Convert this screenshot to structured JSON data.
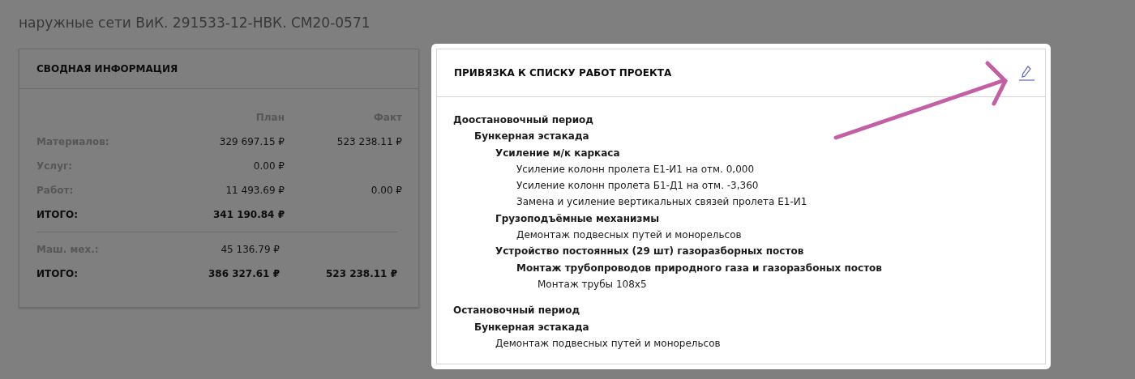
{
  "page_title": "наружные сети ВиК. 291533-12-НВК. СМ20-0571",
  "summary": {
    "title": "СВОДНАЯ ИНФОРМАЦИЯ",
    "columns": [
      "План",
      "Факт"
    ],
    "sections": [
      [
        {
          "label": "Материалов:",
          "plan": "329 697.15 ₽",
          "fact": "523 238.11 ₽",
          "kind": "item"
        },
        {
          "label": "Услуг:",
          "plan": "0.00 ₽",
          "kind": "item"
        },
        {
          "label": "Работ:",
          "plan": "11 493.69 ₽",
          "fact": "0.00 ₽",
          "kind": "item"
        },
        {
          "label": "ИТОГО:",
          "plan": "341 190.84 ₽",
          "kind": "total"
        }
      ],
      [
        {
          "label": "Маш. мех.:",
          "plan": "45 136.79 ₽",
          "kind": "item"
        },
        {
          "label": "ИТОГО:",
          "plan": "386 327.61 ₽",
          "fact": "523 238.11 ₽",
          "kind": "total"
        }
      ]
    ]
  },
  "works": {
    "title": "ПРИВЯЗКА К СПИСКУ РАБОТ ПРОЕКТА",
    "tree": [
      {
        "label": "Доостановочный период",
        "children": [
          {
            "label": "Бункерная эстакада",
            "children": [
              {
                "label": "Усиление м/к каркаса",
                "children": [
                  {
                    "label": "Усиление колонн пролета Е1-И1 на отм. 0,000"
                  },
                  {
                    "label": "Усиление колонн пролета Б1-Д1 на отм. -3,360"
                  },
                  {
                    "label": "Замена и усиление вертикальных связей пролета Е1-И1"
                  }
                ]
              },
              {
                "label": "Грузоподъёмные механизмы",
                "children": [
                  {
                    "label": "Демонтаж подвесных путей и монорельсов"
                  }
                ]
              },
              {
                "label": "Устройство постоянных (29 шт) газоразборных постов",
                "children": [
                  {
                    "label": "Монтаж трубопроводов природного газа и газоразбоных постов",
                    "children": [
                      {
                        "label": "Монтаж трубы 108х5"
                      }
                    ]
                  }
                ]
              }
            ]
          }
        ]
      },
      {
        "label": "Остановочный период",
        "children": [
          {
            "label": "Бункерная эстакада",
            "children": [
              {
                "label": "Демонтаж подвесных путей и монорельсов"
              }
            ]
          }
        ]
      }
    ]
  }
}
